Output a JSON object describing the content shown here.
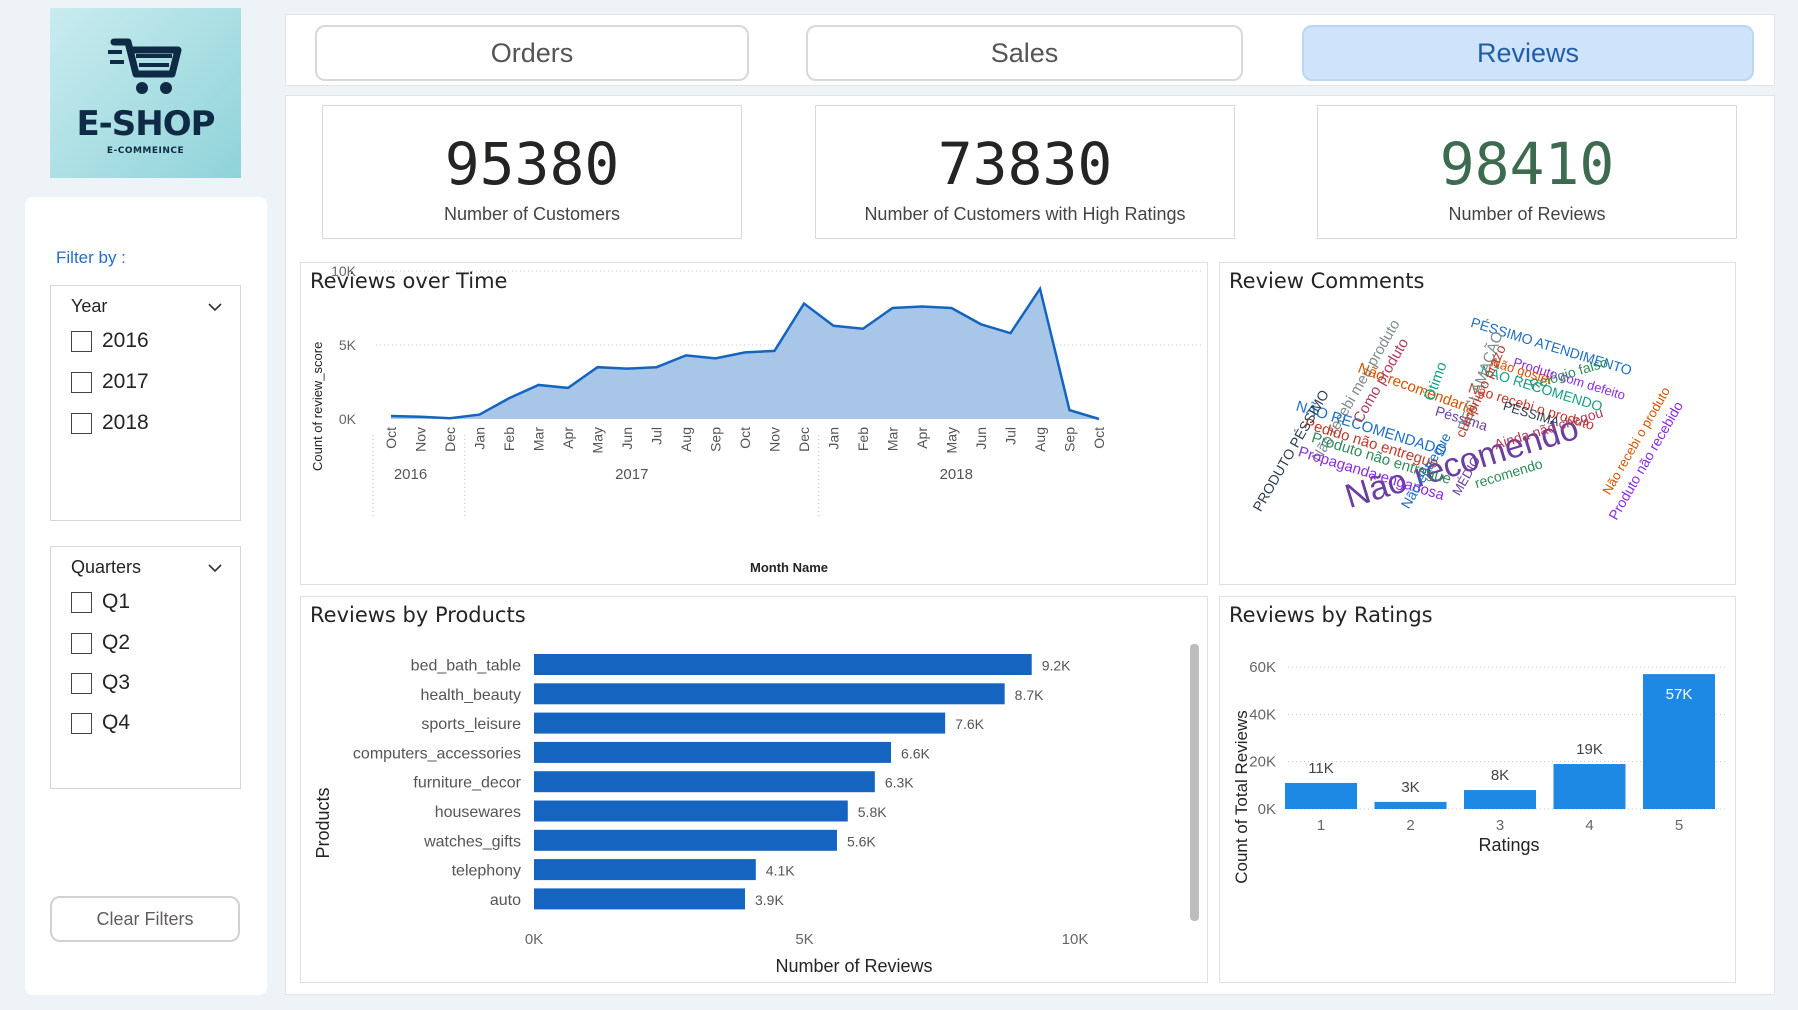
{
  "logo": {
    "title": "E-SHOP",
    "subtitle": "E-COMMEINCE",
    "icon": "cart-icon"
  },
  "nav": {
    "tabs": [
      {
        "label": "Orders"
      },
      {
        "label": "Sales"
      },
      {
        "label": "Reviews",
        "active": true
      }
    ]
  },
  "filters": {
    "title": "Filter by :",
    "year": {
      "label": "Year",
      "options": [
        "2016",
        "2017",
        "2018"
      ]
    },
    "quarters": {
      "label": "Quarters",
      "options": [
        "Q1",
        "Q2",
        "Q3",
        "Q4"
      ]
    },
    "clear_label": "Clear Filters"
  },
  "kpis": [
    {
      "value": "95380",
      "label": "Number of Customers",
      "color": "#252423"
    },
    {
      "value": "73830",
      "label": "Number of Customers with High Ratings",
      "color": "#252423"
    },
    {
      "value": "98410",
      "label": "Number of Reviews",
      "color": "#3d6b4f"
    }
  ],
  "panels": {
    "reviews_over_time": "Reviews over Time",
    "review_comments": "Review Comments",
    "reviews_by_products": "Reviews by Products",
    "reviews_by_ratings": "Reviews by Ratings"
  },
  "wordcloud": [
    "Não recomendo",
    "PÉSSIMO ATENDIMENTO",
    "Não recebi o produto",
    "Relógio falso",
    "Produto com defeito",
    "Não gostei",
    "NÃO RECOMENDO",
    "Não recebi meu produto",
    "Ainda não chegou",
    "PÉSSIMA",
    "Péssima",
    "NÃO RECOMENDADO",
    "Pedido não entregue",
    "Produto não entregue",
    "Propaganda enganosa",
    "Não recomendaria",
    "Ótimo",
    "RECLAMAÇÃO",
    "Como produto",
    "PRODUTO PÉSSIMO",
    "MÉDIO",
    "Não entregue",
    "cumpriu o prazo",
    "recomendo",
    "Produto não recebido",
    "Não recebi o produto"
  ],
  "chart_data": [
    {
      "type": "area",
      "title": "Reviews over Time",
      "xlabel": "Month Name",
      "ylabel": "Count of review_score",
      "y_ticks": [
        "10K",
        "5K",
        "0K"
      ],
      "ylim": [
        0,
        10000
      ],
      "x": [
        "Oct",
        "Nov",
        "Dec",
        "Jan",
        "Feb",
        "Mar",
        "Apr",
        "May",
        "Jun",
        "Jul",
        "Aug",
        "Sep",
        "Oct",
        "Nov",
        "Dec",
        "Jan",
        "Feb",
        "Mar",
        "Apr",
        "May",
        "Jun",
        "Jul",
        "Aug",
        "Sep",
        "Oct"
      ],
      "year_groups": [
        {
          "label": "2016",
          "months": 3
        },
        {
          "label": "2017",
          "months": 12
        },
        {
          "label": "2018",
          "months": 10
        }
      ],
      "values": [
        200,
        150,
        50,
        300,
        1400,
        2300,
        2100,
        3500,
        3400,
        3500,
        4300,
        4100,
        4500,
        4600,
        7800,
        6300,
        6100,
        7500,
        7600,
        7500,
        6400,
        5800,
        8800,
        600,
        0
      ],
      "color": "#1565c0",
      "fill": "#a8c6e8",
      "grid": true
    },
    {
      "type": "bar",
      "orientation": "horizontal",
      "title": "Reviews by Products",
      "xlabel": "Number of Reviews",
      "ylabel": "Products",
      "categories": [
        "bed_bath_table",
        "health_beauty",
        "sports_leisure",
        "computers_accessories",
        "furniture_decor",
        "housewares",
        "watches_gifts",
        "telephony",
        "auto"
      ],
      "values": [
        9200,
        8700,
        7600,
        6600,
        6300,
        5800,
        5600,
        4100,
        3900
      ],
      "labels": [
        "9.2K",
        "8.7K",
        "7.6K",
        "6.6K",
        "6.3K",
        "5.8K",
        "5.6K",
        "4.1K",
        "3.9K"
      ],
      "x_ticks": [
        "0K",
        "5K",
        "10K"
      ],
      "xlim": [
        0,
        10000
      ],
      "color": "#1565c0"
    },
    {
      "type": "bar",
      "title": "Reviews by Ratings",
      "xlabel": "Ratings",
      "ylabel": "Count of Total Reviews",
      "categories": [
        "1",
        "2",
        "3",
        "4",
        "5"
      ],
      "values": [
        11000,
        3000,
        8000,
        19000,
        57000
      ],
      "labels": [
        "11K",
        "3K",
        "8K",
        "19K",
        "57K"
      ],
      "y_ticks": [
        "60K",
        "40K",
        "20K",
        "0K"
      ],
      "ylim": [
        0,
        60000
      ],
      "color": "#1e88e5",
      "grid": true
    }
  ]
}
